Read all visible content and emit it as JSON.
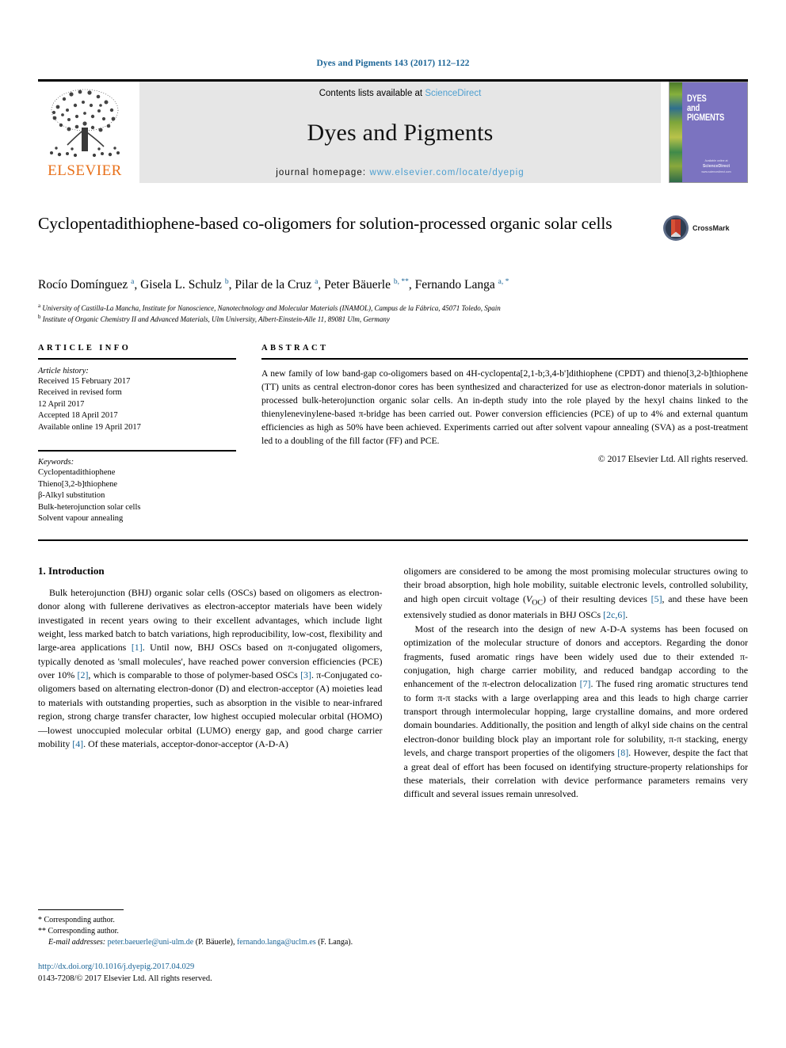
{
  "running_head": "Dyes and Pigments 143 (2017) 112–122",
  "masthead": {
    "publisher_name": "ELSEVIER",
    "contents_prefix": "Contents lists available at ",
    "contents_link": "ScienceDirect",
    "journal_name": "Dyes and Pigments",
    "homepage_prefix": "journal homepage: ",
    "homepage_url": "www.elsevier.com/locate/dyepig",
    "cover": {
      "line1": "DYES",
      "line2": "and",
      "line3": "PIGMENTS",
      "foot_prefix": "Available online at",
      "foot_name": "ScienceDirect",
      "foot_sub": "www.sciencedirect.com"
    }
  },
  "article": {
    "title": "Cyclopentadithiophene-based co-oligomers for solution-processed organic solar cells",
    "crossmark_label": "CrossMark",
    "authors_html": "Rocío Domínguez <sup>a</sup>, Gisela L. Schulz <sup>b</sup>, Pilar de la Cruz <sup>a</sup>, Peter Bäuerle <sup>b, **</sup>, Fernando Langa <sup>a, *</sup>",
    "affiliations": [
      "University of Castilla-La Mancha, Institute for Nanoscience, Nanotechnology and Molecular Materials (INAMOL), Campus de la Fábrica, 45071 Toledo, Spain",
      "Institute of Organic Chemistry II and Advanced Materials, Ulm University, Albert-Einstein-Alle 11, 89081 Ulm, Germany"
    ],
    "affiliation_markers": [
      "a",
      "b"
    ]
  },
  "article_info": {
    "heading": "ARTICLE INFO",
    "history_title": "Article history:",
    "history": [
      "Received 15 February 2017",
      "Received in revised form",
      "12 April 2017",
      "Accepted 18 April 2017",
      "Available online 19 April 2017"
    ],
    "keywords_title": "Keywords:",
    "keywords": [
      "Cyclopentadithiophene",
      "Thieno[3,2-b]thiophene",
      "β-Alkyl substitution",
      "Bulk-heterojunction solar cells",
      "Solvent vapour annealing"
    ]
  },
  "abstract": {
    "heading": "ABSTRACT",
    "body": "A new family of low band-gap co-oligomers based on 4H-cyclopenta[2,1-b;3,4-b']dithiophene (CPDT) and thieno[3,2-b]thiophene (TT) units as central electron-donor cores has been synthesized and characterized for use as electron-donor materials in solution-processed bulk-heterojunction organic solar cells. An in-depth study into the role played by the hexyl chains linked to the thienylenevinylene-based π-bridge has been carried out. Power conversion efficiencies (PCE) of up to 4% and external quantum efficiencies as high as 50% have been achieved. Experiments carried out after solvent vapour annealing (SVA) as a post-treatment led to a doubling of the fill factor (FF) and PCE.",
    "copyright": "© 2017 Elsevier Ltd. All rights reserved."
  },
  "body": {
    "section_title": "1. Introduction",
    "left_paragraphs": [
      "Bulk heterojunction (BHJ) organic solar cells (OSCs) based on oligomers as electron-donor along with fullerene derivatives as electron-acceptor materials have been widely investigated in recent years owing to their excellent advantages, which include light weight, less marked batch to batch variations, high reproducibility, low-cost, flexibility and large-area applications [1]. Until now, BHJ OSCs based on π-conjugated oligomers, typically denoted as 'small molecules', have reached power conversion efficiencies (PCE) over 10% [2], which is comparable to those of polymer-based OSCs [3]. π-Conjugated co-oligomers based on alternating electron-donor (D) and electron-acceptor (A) moieties lead to materials with outstanding properties, such as absorption in the visible to near-infrared region, strong charge transfer character, low highest occupied molecular orbital (HOMO)—lowest unoccupied molecular orbital (LUMO) energy gap, and good charge carrier mobility [4]. Of these materials, acceptor-donor-acceptor (A-D-A)"
    ],
    "right_paragraphs": [
      "oligomers are considered to be among the most promising molecular structures owing to their broad absorption, high hole mobility, suitable electronic levels, controlled solubility, and high open circuit voltage (VOC) of their resulting devices [5], and these have been extensively studied as donor materials in BHJ OSCs [2c,6].",
      "Most of the research into the design of new A-D-A systems has been focused on optimization of the molecular structure of donors and acceptors. Regarding the donor fragments, fused aromatic rings have been widely used due to their extended π-conjugation, high charge carrier mobility, and reduced bandgap according to the enhancement of the π-electron delocalization [7]. The fused ring aromatic structures tend to form π-π stacks with a large overlapping area and this leads to high charge carrier transport through intermolecular hopping, large crystalline domains, and more ordered domain boundaries. Additionally, the position and length of alkyl side chains on the central electron-donor building block play an important role for solubility, π-π stacking, energy levels, and charge transport properties of the oligomers [8]. However, despite the fact that a great deal of effort has been focused on identifying structure-property relationships for these materials, their correlation with device performance parameters remains very difficult and several issues remain unresolved."
    ]
  },
  "footnotes": {
    "corresponding_1": "Corresponding author.",
    "corresponding_1_marker": "*",
    "corresponding_2": "Corresponding author.",
    "corresponding_2_marker": "**",
    "email_label": "E-mail addresses:",
    "email_1": "peter.baeuerle@uni-ulm.de",
    "email_1_person": "(P. Bäuerle),",
    "email_2": "fernando.langa@uclm.es",
    "email_2_person": "(F. Langa).",
    "doi_url": "http://dx.doi.org/10.1016/j.dyepig.2017.04.029",
    "issn_line": "0143-7208/© 2017 Elsevier Ltd. All rights reserved."
  },
  "colors": {
    "link_blue": "#1a6496",
    "sciencedirect_blue": "#4d9fd0",
    "elsevier_orange": "#E8701A",
    "cover_purple": "#7b73c0"
  }
}
